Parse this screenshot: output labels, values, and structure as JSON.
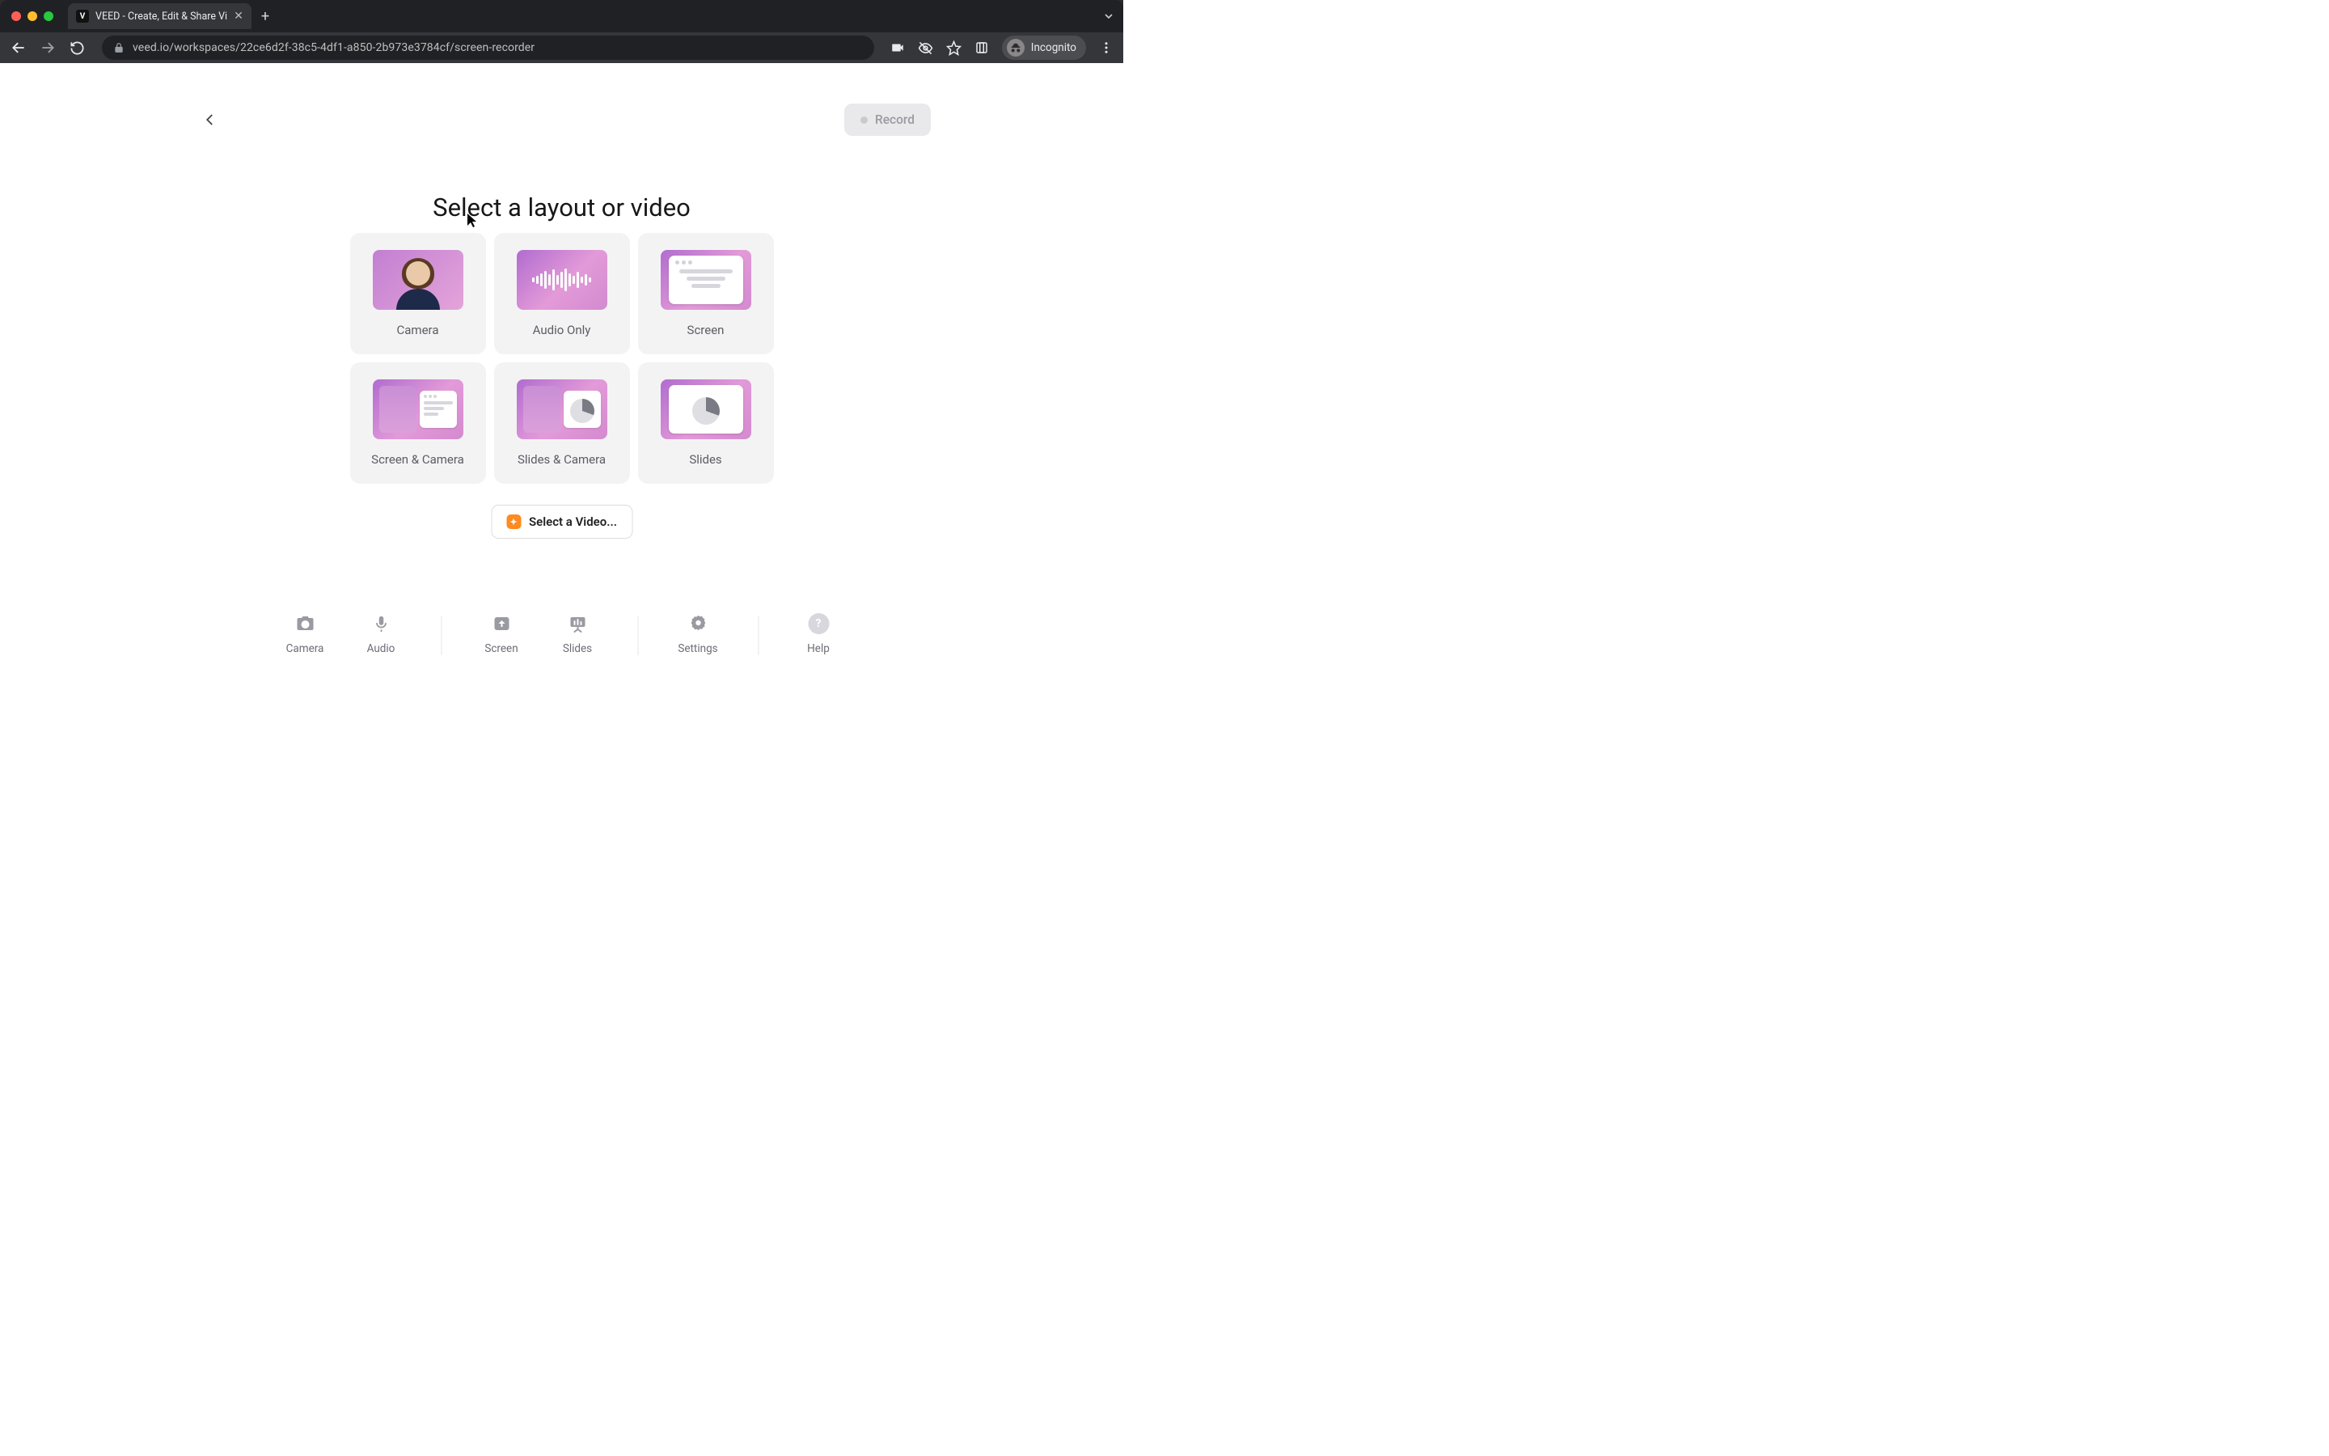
{
  "browser": {
    "tab_title": "VEED - Create, Edit & Share Vi",
    "url": "veed.io/workspaces/22ce6d2f-38c5-4df1-a850-2b973e3784cf/screen-recorder",
    "incognito_label": "Incognito"
  },
  "header": {
    "record_label": "Record"
  },
  "page_title": "Select a layout or video",
  "cards": {
    "camera": "Camera",
    "audio_only": "Audio Only",
    "screen": "Screen",
    "screen_camera": "Screen & Camera",
    "slides_camera": "Slides & Camera",
    "slides": "Slides"
  },
  "select_video_label": "Select a Video...",
  "bottom": {
    "camera": "Camera",
    "audio": "Audio",
    "screen": "Screen",
    "slides": "Slides",
    "settings": "Settings",
    "help": "Help"
  }
}
